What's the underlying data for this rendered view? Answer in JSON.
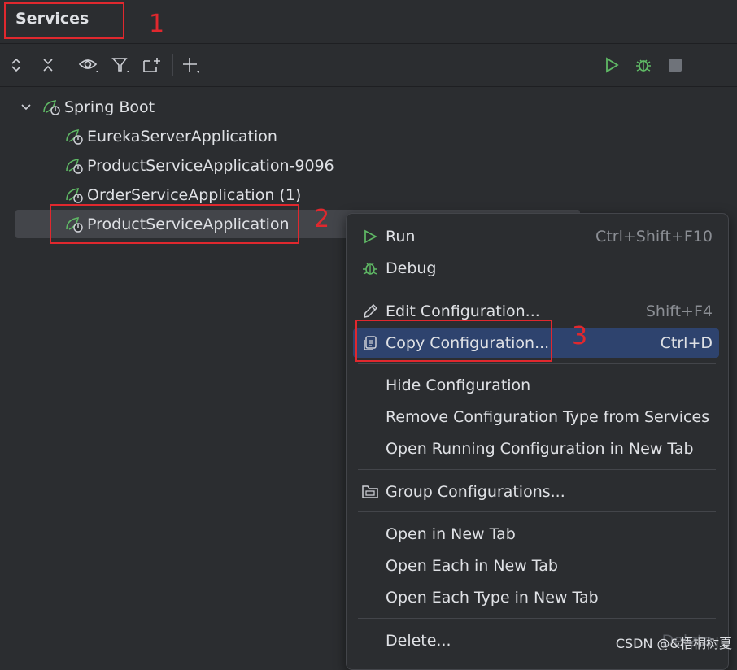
{
  "header": {
    "title": "Services"
  },
  "toolbar": {
    "left_icons": [
      "expand-all-icon",
      "collapse-all-icon",
      "eye-icon",
      "filter-icon",
      "new-tab-icon",
      "add-icon"
    ],
    "right_icons": [
      "run-icon",
      "debug-icon",
      "stop-icon"
    ]
  },
  "tree": {
    "group": "Spring Boot",
    "items": [
      {
        "label": "EurekaServerApplication"
      },
      {
        "label": "ProductServiceApplication-9096"
      },
      {
        "label": "OrderServiceApplication (1)"
      },
      {
        "label": "ProductServiceApplication"
      }
    ]
  },
  "annotations": [
    "1",
    "2",
    "3"
  ],
  "menu": {
    "items": [
      {
        "label": "Run",
        "shortcut": "Ctrl+Shift+F10",
        "icon": "run-icon"
      },
      {
        "label": "Debug",
        "shortcut": "",
        "icon": "debug-icon"
      },
      {
        "label": "Edit Configuration...",
        "shortcut": "Shift+F4",
        "icon": "edit-icon"
      },
      {
        "label": "Copy Configuration...",
        "shortcut": "Ctrl+D",
        "icon": "copy-icon"
      },
      {
        "label": "Hide Configuration",
        "shortcut": ""
      },
      {
        "label": "Remove Configuration Type from Services",
        "shortcut": ""
      },
      {
        "label": "Open Running Configuration in New Tab",
        "shortcut": ""
      },
      {
        "label": "Group Configurations...",
        "shortcut": "",
        "icon": "folder-icon"
      },
      {
        "label": "Open in New Tab",
        "shortcut": ""
      },
      {
        "label": "Open Each in New Tab",
        "shortcut": ""
      },
      {
        "label": "Open Each Type in New Tab",
        "shortcut": ""
      },
      {
        "label": "Delete...",
        "shortcut": "Delete"
      }
    ]
  },
  "watermark": "CSDN @&梧桐树夏",
  "colors": {
    "accent": "#2e436e",
    "run_green": "#5fb865",
    "annotation_red": "#e0282e"
  }
}
